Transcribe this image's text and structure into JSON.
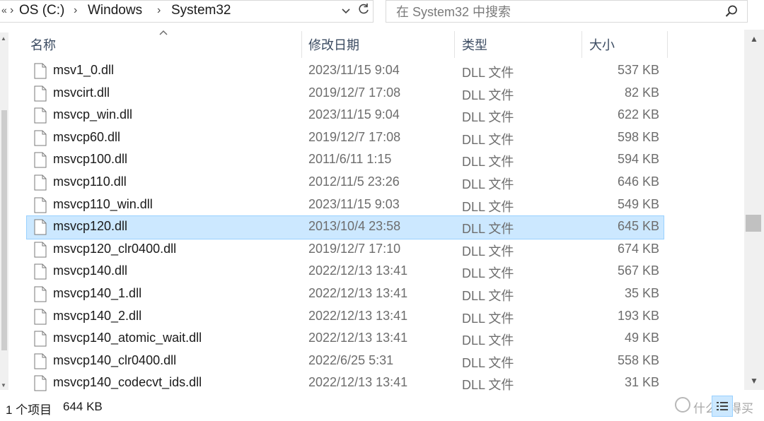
{
  "address": {
    "overflow_glyph": "«",
    "crumbs": [
      "OS (C:)",
      "Windows",
      "System32"
    ],
    "separator": "›"
  },
  "search": {
    "placeholder": "在 System32 中搜索"
  },
  "columns": {
    "name": "名称",
    "date": "修改日期",
    "type": "类型",
    "size": "大小"
  },
  "files": [
    {
      "name": "msv1_0.dll",
      "date": "2023/11/15 9:04",
      "type": "DLL 文件",
      "size": "537 KB"
    },
    {
      "name": "msvcirt.dll",
      "date": "2019/12/7 17:08",
      "type": "DLL 文件",
      "size": "82 KB"
    },
    {
      "name": "msvcp_win.dll",
      "date": "2023/11/15 9:04",
      "type": "DLL 文件",
      "size": "622 KB"
    },
    {
      "name": "msvcp60.dll",
      "date": "2019/12/7 17:08",
      "type": "DLL 文件",
      "size": "598 KB"
    },
    {
      "name": "msvcp100.dll",
      "date": "2011/6/11 1:15",
      "type": "DLL 文件",
      "size": "594 KB"
    },
    {
      "name": "msvcp110.dll",
      "date": "2012/11/5 23:26",
      "type": "DLL 文件",
      "size": "646 KB"
    },
    {
      "name": "msvcp110_win.dll",
      "date": "2023/11/15 9:03",
      "type": "DLL 文件",
      "size": "549 KB"
    },
    {
      "name": "msvcp120.dll",
      "date": "2013/10/4 23:58",
      "type": "DLL 文件",
      "size": "645 KB",
      "selected": true
    },
    {
      "name": "msvcp120_clr0400.dll",
      "date": "2019/12/7 17:10",
      "type": "DLL 文件",
      "size": "674 KB"
    },
    {
      "name": "msvcp140.dll",
      "date": "2022/12/13 13:41",
      "type": "DLL 文件",
      "size": "567 KB"
    },
    {
      "name": "msvcp140_1.dll",
      "date": "2022/12/13 13:41",
      "type": "DLL 文件",
      "size": "35 KB"
    },
    {
      "name": "msvcp140_2.dll",
      "date": "2022/12/13 13:41",
      "type": "DLL 文件",
      "size": "193 KB"
    },
    {
      "name": "msvcp140_atomic_wait.dll",
      "date": "2022/12/13 13:41",
      "type": "DLL 文件",
      "size": "49 KB"
    },
    {
      "name": "msvcp140_clr0400.dll",
      "date": "2022/6/25 5:31",
      "type": "DLL 文件",
      "size": "558 KB"
    },
    {
      "name": "msvcp140_codecvt_ids.dll",
      "date": "2022/12/13 13:41",
      "type": "DLL 文件",
      "size": "31 KB"
    }
  ],
  "status": {
    "count": "1 个项目",
    "size": "644 KB"
  },
  "watermark": "什么值得买",
  "icons": {
    "search": "search-icon",
    "refresh": "refresh-icon",
    "dropdown": "chevron-down-icon",
    "file": "dll-file-icon",
    "view": "details-view-icon"
  },
  "colors": {
    "selection_bg": "#cce8ff",
    "selection_border": "#99d1ff",
    "header_text": "#3b4b61",
    "meta_text": "#6d6d6d"
  }
}
